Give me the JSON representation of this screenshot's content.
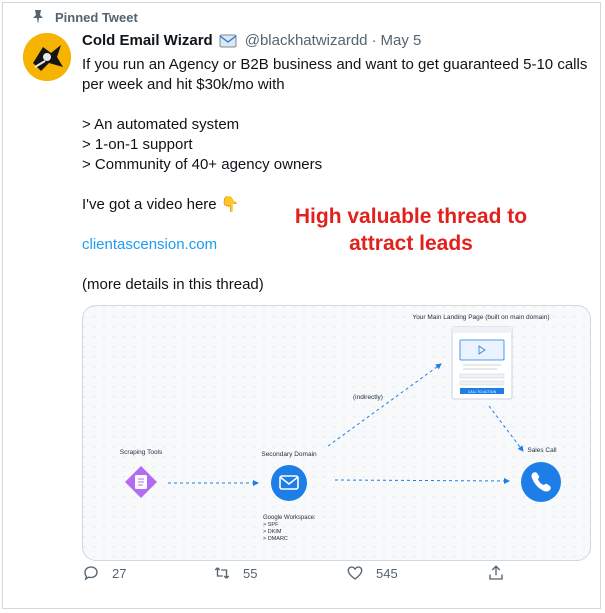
{
  "pinned": {
    "label": "Pinned Tweet",
    "icon": "pin-icon"
  },
  "author": {
    "name": "Cold Email Wizard",
    "handle": "@blackhatwizardd",
    "separator": "·",
    "date": "May 5",
    "badge_icon": "envelope-badge-icon"
  },
  "tweet": {
    "line1": "If you run an Agency or B2B business and want to get guaranteed 5-10 calls per week and hit $30k/mo with",
    "bullet1": "> An automated system",
    "bullet2": "> 1-on-1 support",
    "bullet3": "> Community of 40+ agency owners",
    "video_line": "I've got a video here 👇",
    "link": "clientascension.com",
    "more": "(more details in this thread)"
  },
  "annotation": {
    "line1": "High valuable thread to",
    "line2": "attract leads",
    "color": "#e3211c"
  },
  "diagram": {
    "landing_title": "Your Main Landing Page (built on main domain)",
    "cta": "CALL TO ACTION",
    "indirectly": "(indirectly)",
    "scraping": "Scraping Tools",
    "secondary": "Secondary Domain",
    "sales": "Sales Call",
    "workspace_title": "Google Workspace:",
    "workspace_items": [
      "> SPF",
      "> DKIM",
      "> DMARC"
    ]
  },
  "actions": {
    "replies": "27",
    "retweets": "55",
    "likes": "545"
  },
  "colors": {
    "link": "#1d9bf0",
    "secondary_text": "#536471",
    "accent_blue": "#1d7ee8",
    "purple": "#b26bf2"
  }
}
